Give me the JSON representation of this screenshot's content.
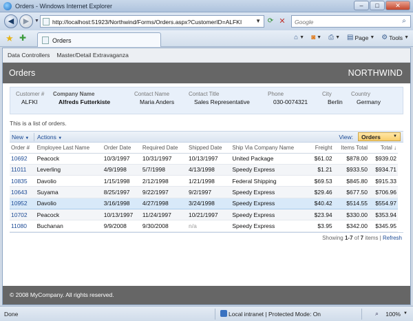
{
  "window": {
    "title": "Orders - Windows Internet Explorer",
    "min": "–",
    "max": "□",
    "close": "✕"
  },
  "address": {
    "url": "http://localhost:51923/Northwind/Forms/Orders.aspx?CustomerID=ALFKI"
  },
  "search": {
    "placeholder": "Google"
  },
  "tab": {
    "label": "Orders"
  },
  "commands": {
    "page": "Page",
    "tools": "Tools"
  },
  "menu": {
    "items": [
      "Data Controllers",
      "Master/Detail Extravaganza"
    ]
  },
  "header": {
    "title": "Orders",
    "brand": "NORTHWIND"
  },
  "customer": {
    "customer_id_label": "Customer #",
    "customer_id": "ALFKI",
    "company_label": "Company Name",
    "company": "Alfreds Futterkiste",
    "contact_name_label": "Contact Name",
    "contact_name": "Maria Anders",
    "contact_title_label": "Contact Title",
    "contact_title": "Sales Representative",
    "phone_label": "Phone",
    "phone": "030-0074321",
    "city_label": "City",
    "city": "Berlin",
    "country_label": "Country",
    "country": "Germany"
  },
  "description": "This is a list of orders.",
  "actions": {
    "new": "New",
    "actions": "Actions",
    "view_label": "View:",
    "view": "Orders"
  },
  "grid": {
    "columns": [
      "Order #",
      "Employee Last Name",
      "Order Date",
      "Required Date",
      "Shipped Date",
      "Ship Via Company Name",
      "Freight",
      "Items Total",
      "Total ↓"
    ],
    "rows": [
      [
        "10692",
        "Peacock",
        "10/3/1997",
        "10/31/1997",
        "10/13/1997",
        "United Package",
        "$61.02",
        "$878.00",
        "$939.02"
      ],
      [
        "11011",
        "Leverling",
        "4/9/1998",
        "5/7/1998",
        "4/13/1998",
        "Speedy Express",
        "$1.21",
        "$933.50",
        "$934.71"
      ],
      [
        "10835",
        "Davolio",
        "1/15/1998",
        "2/12/1998",
        "1/21/1998",
        "Federal Shipping",
        "$69.53",
        "$845.80",
        "$915.33"
      ],
      [
        "10643",
        "Suyama",
        "8/25/1997",
        "9/22/1997",
        "9/2/1997",
        "Speedy Express",
        "$29.46",
        "$677.50",
        "$706.96"
      ],
      [
        "10952",
        "Davolio",
        "3/16/1998",
        "4/27/1998",
        "3/24/1998",
        "Speedy Express",
        "$40.42",
        "$514.55",
        "$554.97"
      ],
      [
        "10702",
        "Peacock",
        "10/13/1997",
        "11/24/1997",
        "10/21/1997",
        "Speedy Express",
        "$23.94",
        "$330.00",
        "$353.94"
      ],
      [
        "11080",
        "Buchanan",
        "9/9/2008",
        "9/30/2008",
        "n/a",
        "Speedy Express",
        "$3.95",
        "$342.00",
        "$345.95"
      ]
    ]
  },
  "pager": {
    "prefix": "Showing ",
    "range": "1-7",
    "of": " of ",
    "count": "7",
    "suffix": " items | ",
    "refresh": "Refresh"
  },
  "footer": "© 2008 MyCompany. All rights reserved.",
  "status": {
    "done": "Done",
    "zone": "Local intranet | Protected Mode: On",
    "zoom": "100%"
  }
}
